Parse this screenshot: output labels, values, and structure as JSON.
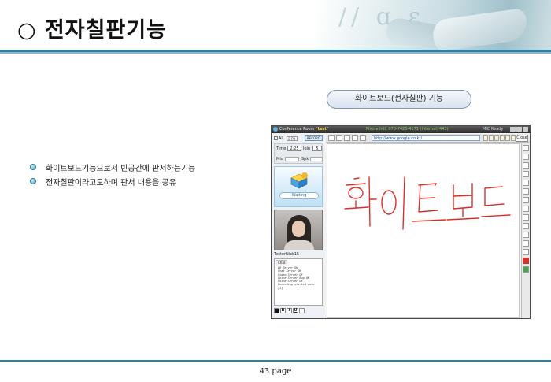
{
  "slide": {
    "title": "○ 전자칠판기능",
    "caption": "화이트보드(전자칠판) 기능",
    "bullets": [
      "화이트보드기능으로서 빈공간에 판서하는기능",
      "전자칠판이라고도하며 판서 내용을 공유"
    ],
    "page_label": "43 page"
  },
  "app": {
    "window_title_prefix": "Conference Room",
    "window_title_room": "\"test\"",
    "phone_text": "Phone Intl: 070-7425-4171 (Internal: 443)",
    "status_text": "MIC Ready",
    "url": "http://www.google.co.kr/",
    "close_label": "Close",
    "left_panel": {
      "all_label": "All",
      "room_select": "8 PR",
      "rec_label": "RECORD",
      "time_label": "Time",
      "time_value": "2:25",
      "join_label": "Join",
      "join_value": "5",
      "mic_label": "Mic",
      "spk_label": "Spk",
      "waiting_label": "Waiting",
      "video_name": "TesterNick15",
      "chat_tab": "Chat",
      "chat_lines": [
        "DB Server OK",
        "Chat Server OK",
        "Video Server OK",
        "Voice Server Bug OK",
        "Voice Server OK",
        "Recording started  auto",
        "[1]"
      ]
    },
    "board": {
      "handwriting_text": "화이트보드",
      "ink_color": "#d9302a"
    }
  }
}
